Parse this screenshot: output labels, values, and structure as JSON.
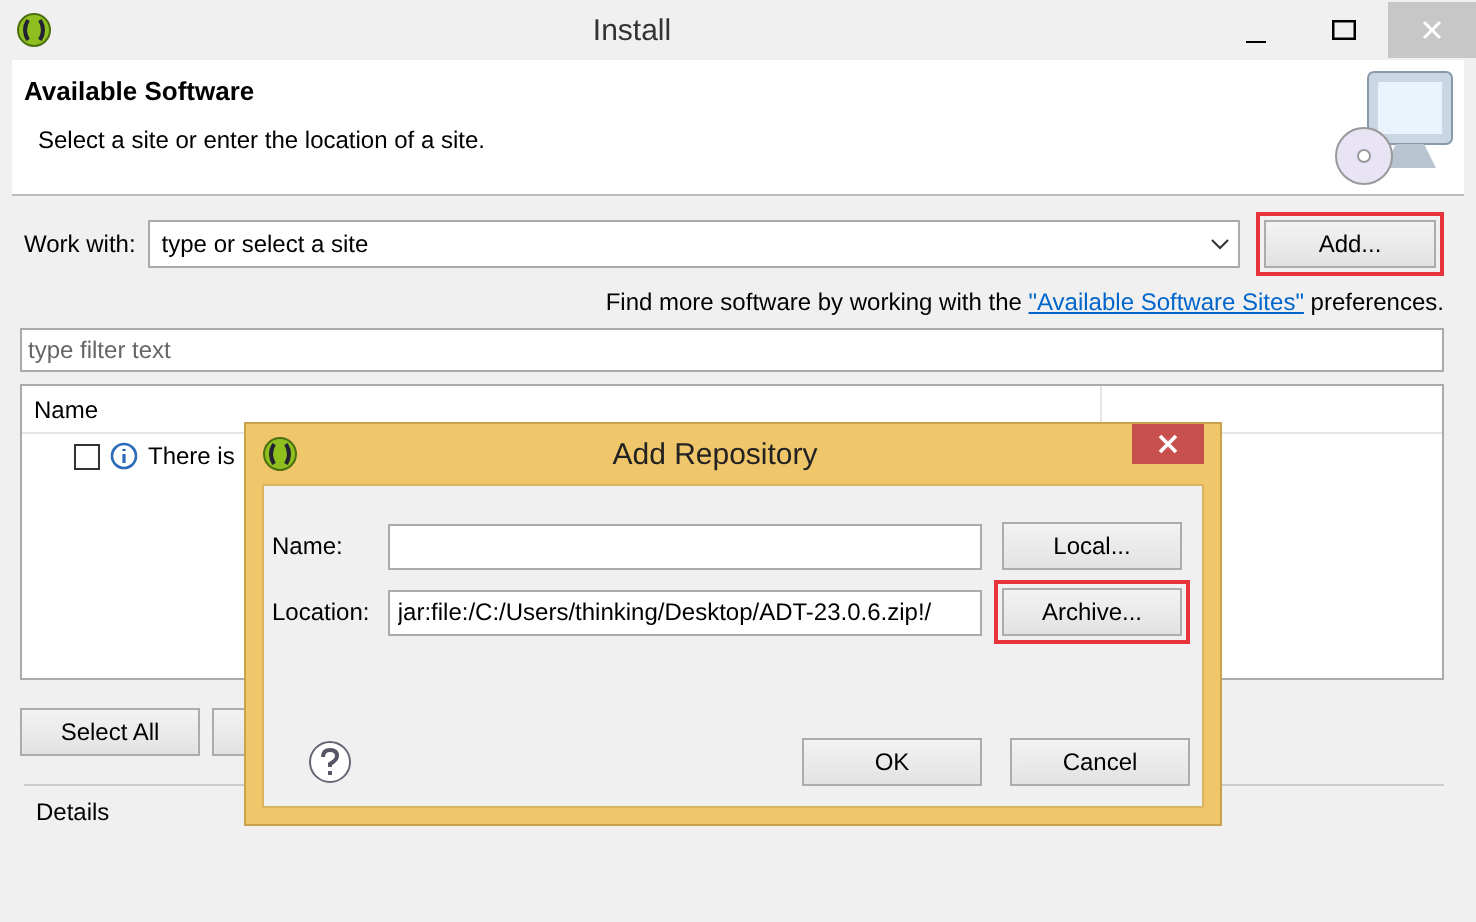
{
  "window": {
    "title": "Install"
  },
  "header": {
    "title": "Available Software",
    "subtitle": "Select a site or enter the location of a site."
  },
  "work_with": {
    "label": "Work with:",
    "placeholder": "type or select a site",
    "add_button": {
      "label": "Add...",
      "highlighted": true
    }
  },
  "more_info": {
    "before": "Find more software by working with the ",
    "link": "\"Available Software Sites\"",
    "after": " preferences."
  },
  "filter": {
    "placeholder": "type filter text"
  },
  "table": {
    "columns": [
      "Name"
    ],
    "rows": [
      {
        "checked": false,
        "text": "There is"
      }
    ]
  },
  "buttons": [
    {
      "kind": "text",
      "label": "Select All"
    },
    {
      "kind": "blank"
    }
  ],
  "details": {
    "label": "Details"
  },
  "dialog": {
    "title": "Add Repository",
    "fields": [
      {
        "label": "Name:",
        "button": {
          "label": "Local...",
          "highlighted": false
        }
      },
      {
        "label": "Location:",
        "value": "jar:file:/C:/Users/thinking/Desktop/ADT-23.0.6.zip!/",
        "button": {
          "label": "Archive...",
          "highlighted": true
        }
      }
    ],
    "buttons": [
      "OK",
      "Cancel"
    ]
  }
}
